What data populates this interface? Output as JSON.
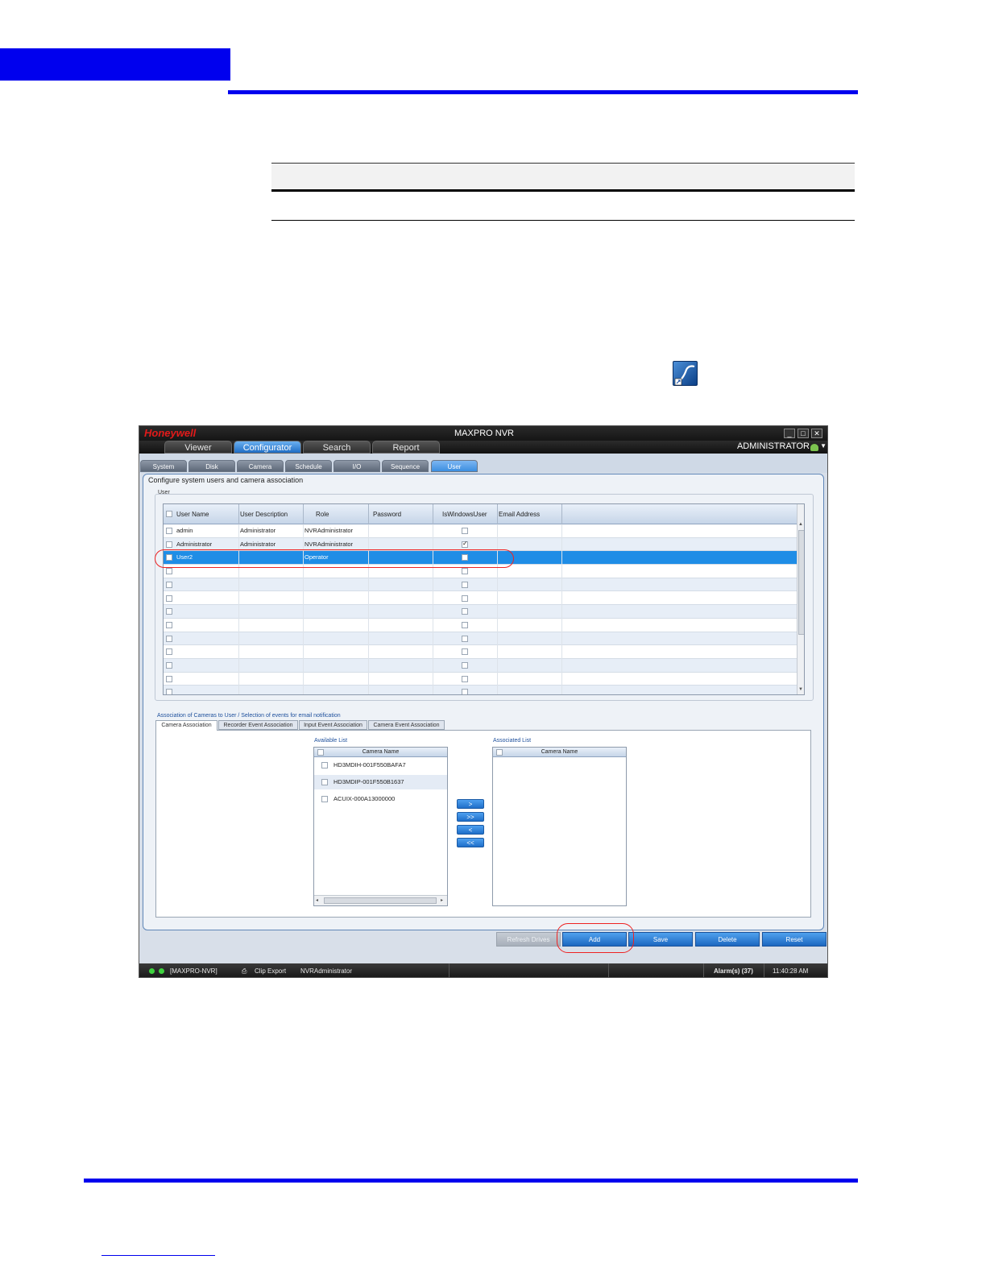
{
  "window": {
    "brand": "Honeywell",
    "title": "MAXPRO NVR",
    "controls": [
      "_",
      "□",
      "✕"
    ]
  },
  "main_tabs": [
    {
      "label": "Viewer"
    },
    {
      "label": "Configurator"
    },
    {
      "label": "Search"
    },
    {
      "label": "Report"
    }
  ],
  "current_user": "ADMINISTRATOR",
  "sub_tabs": [
    {
      "label": "System"
    },
    {
      "label": "Disk"
    },
    {
      "label": "Camera"
    },
    {
      "label": "Schedule"
    },
    {
      "label": "I/O"
    },
    {
      "label": "Sequence"
    },
    {
      "label": "User"
    }
  ],
  "panel_caption": "Configure system users and camera association",
  "user_group_caption": "User",
  "user_grid": {
    "columns": [
      "User Name",
      "User Description",
      "Role",
      "Password",
      "IsWindowsUser",
      "Email Address"
    ],
    "rows": [
      {
        "name": "admin",
        "description": "Administrator",
        "role": "NVRAdministrator",
        "password": "",
        "is_windows_user": false,
        "email": ""
      },
      {
        "name": "Administrator",
        "description": "Administrator",
        "role": "NVRAdministrator",
        "password": "",
        "is_windows_user": true,
        "email": ""
      },
      {
        "name": "User2",
        "description": "",
        "role": "Operator",
        "password": "",
        "is_windows_user": false,
        "email": ""
      }
    ]
  },
  "association": {
    "caption": "Association of Cameras to User / Selection of events for email notification",
    "tabs": [
      {
        "label": "Camera Association"
      },
      {
        "label": "Recorder Event Association"
      },
      {
        "label": "Input Event Association"
      },
      {
        "label": "Camera Event Association"
      }
    ],
    "available_label": "Available List",
    "associated_label": "Associated List",
    "column_header": "Camera Name",
    "available_items": [
      "HD3MDIH-001F550BAFA7",
      "HD3MDIP-001F550B1637",
      "ACUIX-000A13000000"
    ],
    "move_buttons": [
      ">",
      ">>",
      "<",
      "<<"
    ]
  },
  "actions": {
    "refresh": "Refresh Drives",
    "add": "Add",
    "save": "Save",
    "delete": "Delete",
    "reset": "Reset"
  },
  "status_bar": {
    "server": "[MAXPRO-NVR]",
    "clip_export": "Clip Export",
    "role": "NVRAdministrator",
    "alarms": "Alarm(s) (37)",
    "time": "11:40:28 AM"
  },
  "colors": {
    "doc_accent": "#0000ee",
    "selected_row": "#1f8de6",
    "button_blue": "#1c67c0",
    "callout": "#ee2222"
  },
  "icons": {
    "shortcut": "maxpro-app-shortcut-icon",
    "user": "user-group-icon",
    "clip_export": "clip-export-icon"
  }
}
